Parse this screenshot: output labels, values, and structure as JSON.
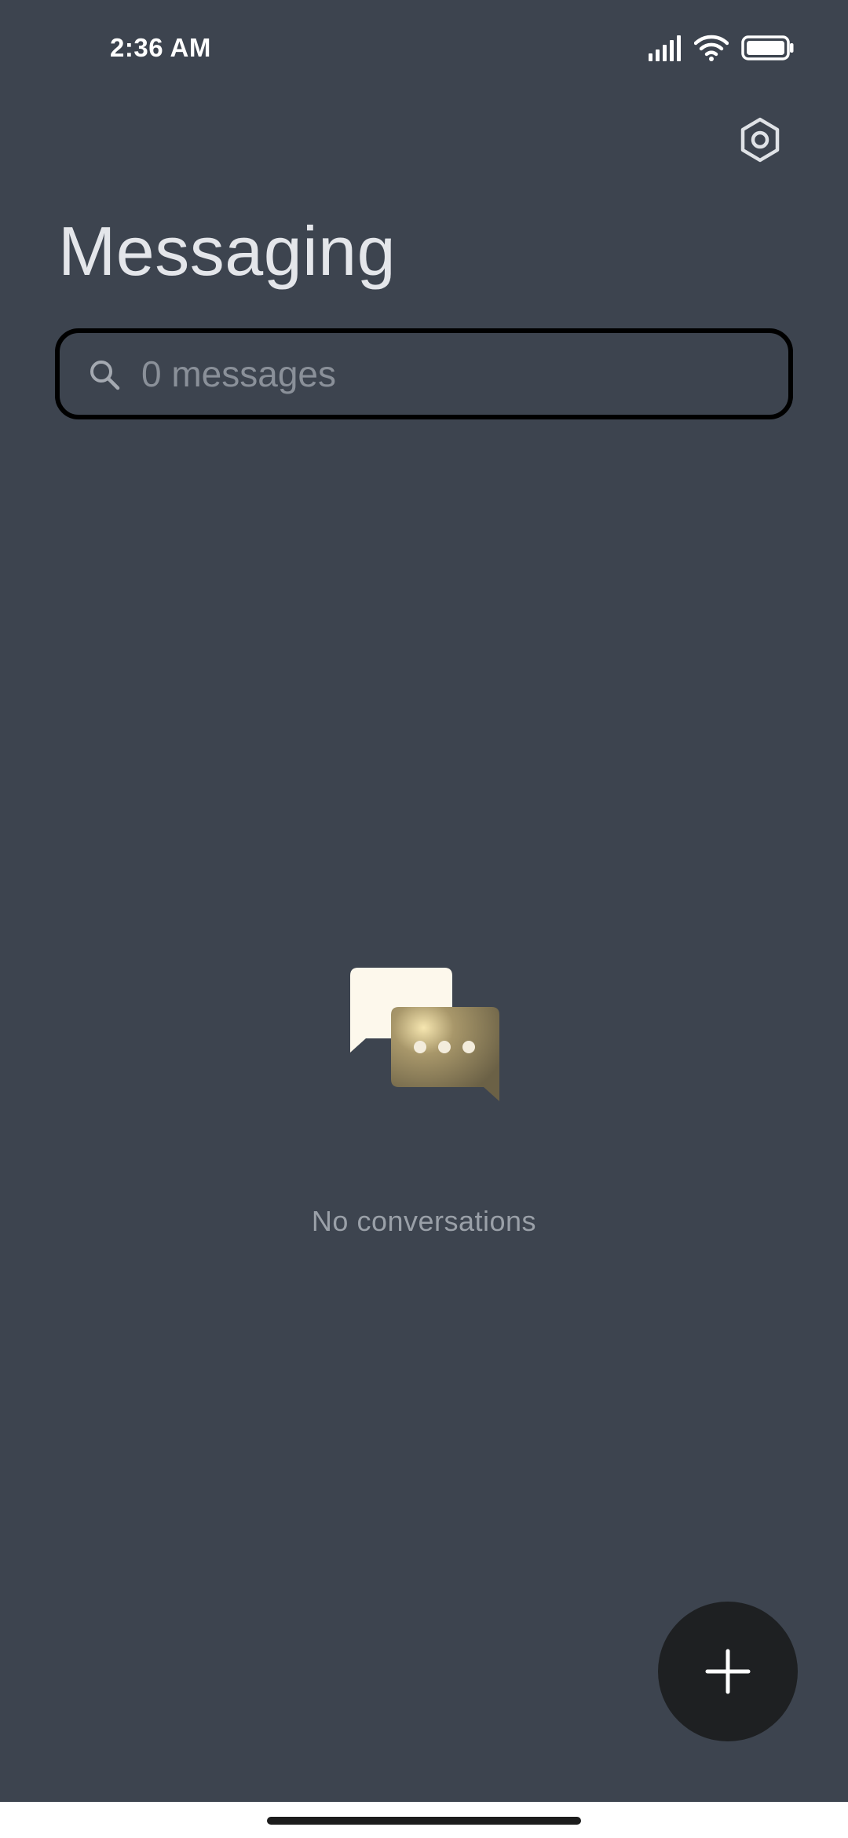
{
  "status_bar": {
    "time": "2:36 AM",
    "icons": [
      "signal-icon",
      "wifi-icon",
      "battery-icon"
    ]
  },
  "header": {
    "title": "Messaging",
    "settings_icon": "settings-icon"
  },
  "search": {
    "placeholder": "0 messages",
    "value": "",
    "icon": "search-icon"
  },
  "empty_state": {
    "illustration": "chat-bubbles-icon",
    "message": "No conversations"
  },
  "fab": {
    "icon": "plus-icon",
    "action": "new-conversation"
  },
  "colors": {
    "background": "#3d444f",
    "fab_background": "#1e2022",
    "search_border": "#000000",
    "bubble_light": "#fdf8ec",
    "bubble_gold": "#6e6446"
  }
}
